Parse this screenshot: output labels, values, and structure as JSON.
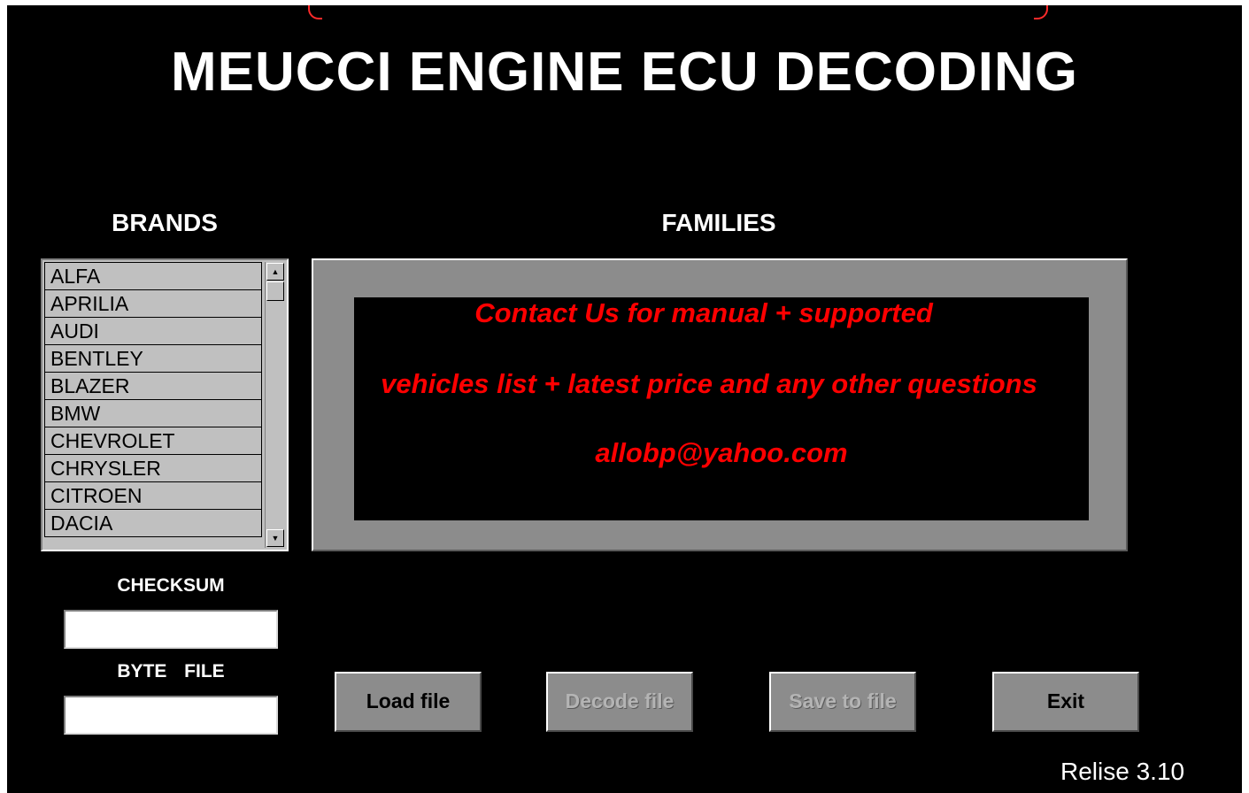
{
  "app": {
    "title": "MEUCCI ENGINE ECU DECODING",
    "release": "Relise 3.10"
  },
  "brands": {
    "heading": "BRANDS",
    "items": [
      "ALFA",
      "APRILIA",
      "AUDI",
      "BENTLEY",
      "BLAZER",
      "BMW",
      "CHEVROLET",
      "CHRYSLER",
      "CITROEN",
      "DACIA"
    ]
  },
  "families": {
    "heading": "FAMILIES",
    "contact_lines": [
      "Contact Us for manual + supported",
      "vehicles list + latest price and any other questions",
      "allobp@yahoo.com"
    ]
  },
  "fields": {
    "checksum_label": "CHECKSUM",
    "checksum_value": "",
    "bytefile_label": "BYTE FILE",
    "bytefile_value": ""
  },
  "buttons": {
    "load": "Load file",
    "decode": "Decode file",
    "save": "Save to file",
    "exit": "Exit"
  },
  "colors": {
    "background": "#000000",
    "panel_gray": "#8c8c8c",
    "contact_text": "#ff0000"
  }
}
